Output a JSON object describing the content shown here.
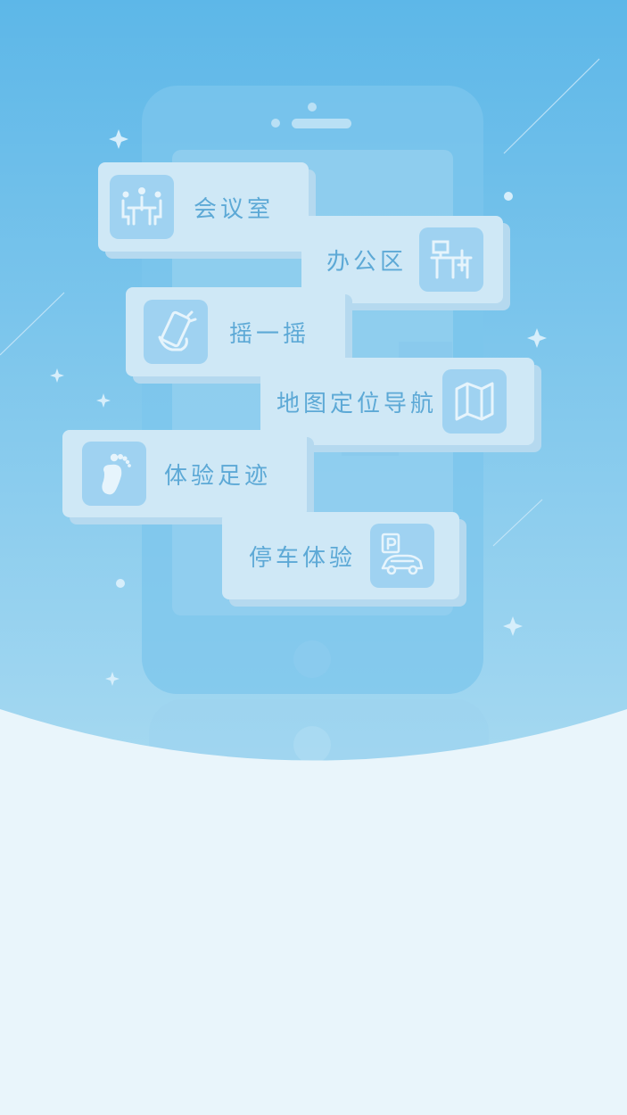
{
  "colors": {
    "sky_top": "#5db7e8",
    "sky_bottom": "#9fd6f0",
    "page_bg": "#e9f5fb",
    "card_bg": "#cfe8f6",
    "icon_bg": "#9fd2f1",
    "label_text": "#5da9d6"
  },
  "cards": {
    "meeting_room": {
      "label": "会议室",
      "icon": "meeting-room-icon"
    },
    "office_area": {
      "label": "办公区",
      "icon": "office-desk-icon"
    },
    "shake": {
      "label": "摇一摇",
      "icon": "shake-phone-icon"
    },
    "map_navigation": {
      "label": "地图定位导航",
      "icon": "map-icon"
    },
    "footprints": {
      "label": "体验足迹",
      "icon": "footprint-icon"
    },
    "parking": {
      "label": "停车体验",
      "icon": "parking-car-icon"
    }
  }
}
